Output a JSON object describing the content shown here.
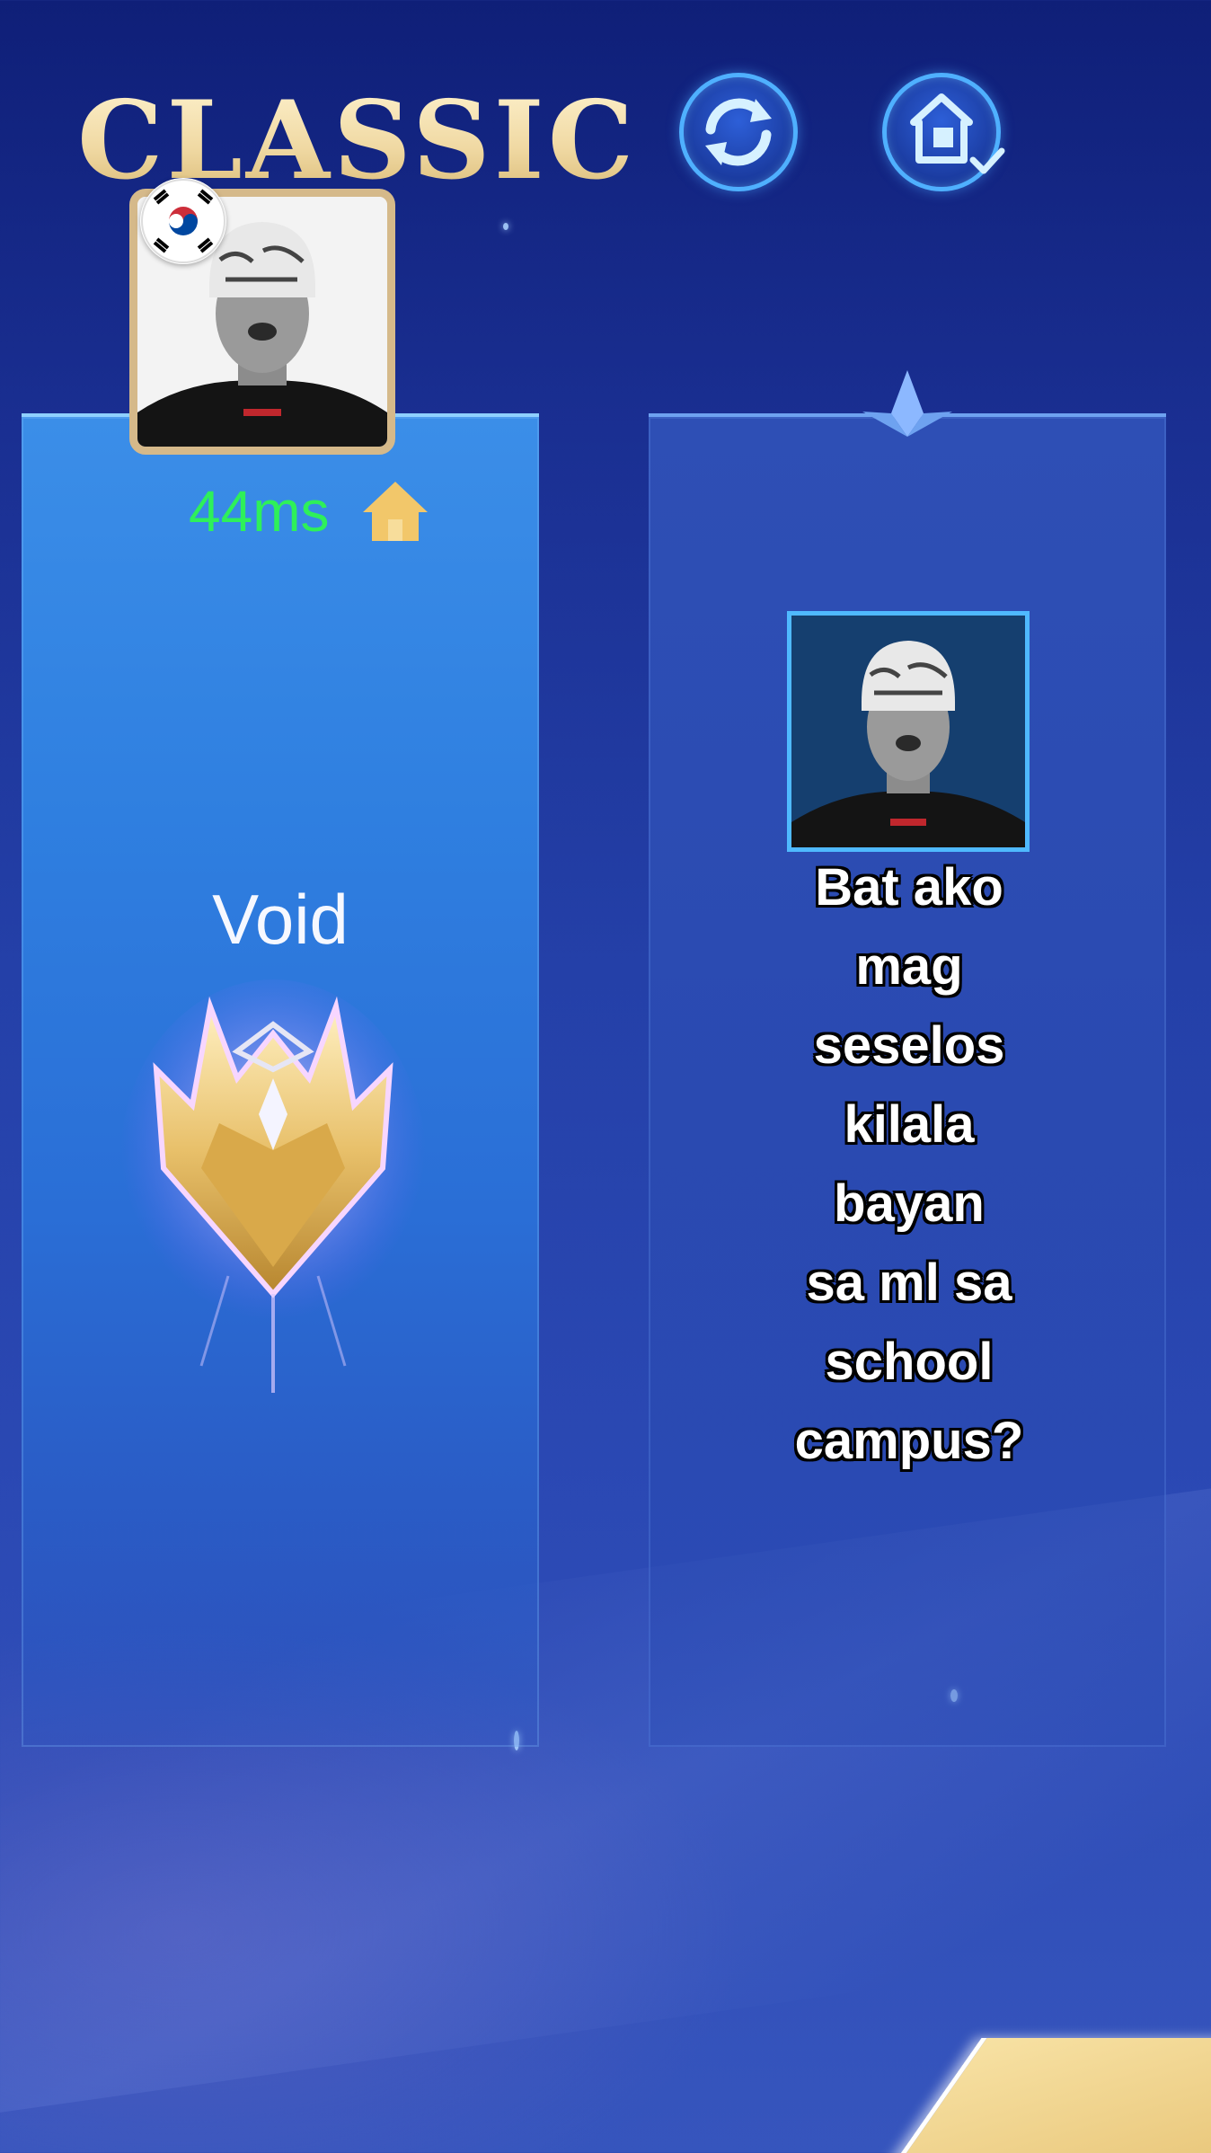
{
  "header": {
    "mode_title": "CLASSIC",
    "refresh_button_icon": "refresh-icon",
    "home_button_icon": "home-check-icon"
  },
  "left_slot": {
    "ping": "44ms",
    "ping_icon": "house-icon",
    "flag_icon": "south-korea-flag-icon",
    "player_name": "Void",
    "rank_icon": "mythic-rank-emblem-icon"
  },
  "right_slot": {
    "caption_lines": [
      "Bat ako",
      "mag",
      "seselos",
      "kilala",
      "bayan",
      "sa ml sa",
      "school",
      "campus?"
    ]
  },
  "colors": {
    "title_gold": "#f0d9a3",
    "ping_green": "#2ef05a",
    "left_panel": "#2f7fe0",
    "right_panel": "#2b4bb2",
    "frame_gold": "#d5b98a",
    "frame_blue": "#4fb9ff"
  }
}
